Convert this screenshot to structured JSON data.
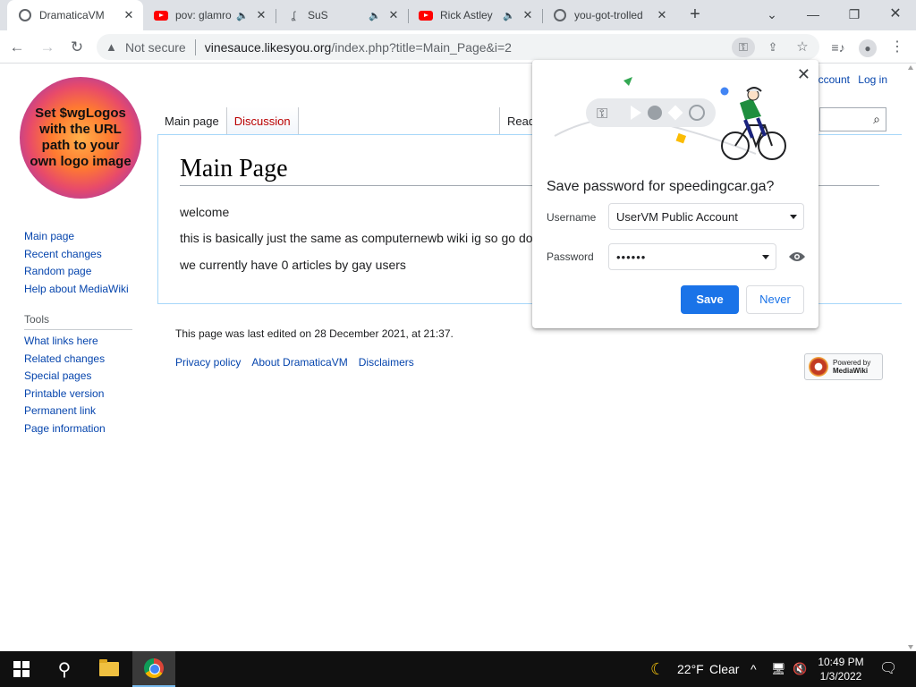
{
  "browser": {
    "tabs": [
      {
        "title": "DramaticaVM",
        "favicon": "globe-icon",
        "audio": false,
        "active": true
      },
      {
        "title": "pov: glamro",
        "favicon": "youtube-icon",
        "audio": true,
        "active": false
      },
      {
        "title": "SuS",
        "favicon": "page-icon",
        "audio": true,
        "active": false
      },
      {
        "title": "Rick Astley",
        "favicon": "youtube-icon",
        "audio": true,
        "active": false
      },
      {
        "title": "you-got-trolled",
        "favicon": "globe-icon",
        "audio": false,
        "active": false
      }
    ],
    "security_label": "Not secure",
    "url_host": "vinesauce.likesyou.org",
    "url_path": "/index.php?title=Main_Page&i=2"
  },
  "wiki": {
    "logo_text": "Set $wgLogos with the URL path to your own logo image",
    "nav": [
      "Main page",
      "Recent changes",
      "Random page",
      "Help about MediaWiki"
    ],
    "tools_heading": "Tools",
    "tools": [
      "What links here",
      "Related changes",
      "Special pages",
      "Printable version",
      "Permanent link",
      "Page information"
    ],
    "tabs": {
      "main": "Main page",
      "discussion": "Discussion",
      "read": "Read"
    },
    "account_links": {
      "create": "ccount",
      "login": "Log in"
    },
    "title": "Main Page",
    "paragraphs": [
      "welcome",
      "this is basically just the same as computernewb wiki ig so go do",
      "we currently have 0 articles by gay users"
    ],
    "footer_edited": "This page was last edited on 28 December 2021, at 21:37.",
    "footer_links": [
      "Privacy policy",
      "About DramaticaVM",
      "Disclaimers"
    ],
    "powered_by": {
      "line1": "Powered by",
      "line2": "MediaWiki"
    }
  },
  "password_bubble": {
    "heading": "Save password for speedingcar.ga?",
    "username_label": "Username",
    "username_value": "UserVM Public Account",
    "password_label": "Password",
    "password_value": "••••••",
    "save_label": "Save",
    "never_label": "Never"
  },
  "taskbar": {
    "weather_temp": "22°F",
    "weather_desc": "Clear",
    "time": "10:49 PM",
    "date": "1/3/2022"
  },
  "colors": {
    "link": "#0645ad",
    "redlink": "#ba0000",
    "save_button": "#1a73e8"
  }
}
